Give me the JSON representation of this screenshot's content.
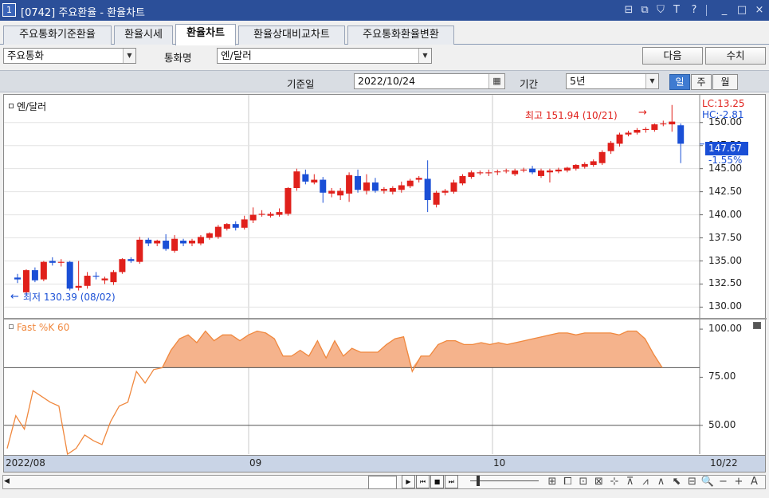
{
  "window": {
    "number": "1",
    "title": "[0742] 주요환율 - 환율차트",
    "controls": [
      "restore-icon",
      "popout-icon",
      "pin-icon",
      "font-icon",
      "help-icon",
      "minimize-icon",
      "maximize-icon",
      "close-icon"
    ],
    "control_glyphs": [
      "⊟",
      "⧉",
      "⛉",
      "T",
      "?",
      "_",
      "□",
      "×"
    ]
  },
  "tabs": [
    {
      "label": "주요통화기준환율",
      "active": false
    },
    {
      "label": "환율시세",
      "active": false
    },
    {
      "label": "환율차트",
      "active": true
    },
    {
      "label": "환율상대비교차트",
      "active": false
    },
    {
      "label": "주요통화환율변환",
      "active": false
    }
  ],
  "toolbar": {
    "category_select": "주요통화",
    "currency_label": "통화명",
    "currency_select": "엔/달러",
    "next_button": "다음",
    "value_button": "수치"
  },
  "query": {
    "base_date_label": "기준일",
    "base_date": "2022/10/24",
    "period_label": "기간",
    "period_select": "5년",
    "periods": [
      {
        "label": "일",
        "active": true
      },
      {
        "label": "주",
        "active": false
      },
      {
        "label": "월",
        "active": false
      }
    ]
  },
  "chart_data": [
    {
      "type": "candlestick",
      "title": "엔/달러",
      "lc_label": "LC:13.25",
      "hc_label": "HC:-2.81",
      "ylim": [
        129.0,
        153.0
      ],
      "ytick_labels": [
        "150.00",
        "147.50",
        "145.00",
        "142.50",
        "140.00",
        "137.50",
        "135.00",
        "132.50",
        "130.00"
      ],
      "ytick_values": [
        150,
        147.5,
        145,
        142.5,
        140,
        137.5,
        135,
        132.5,
        130
      ],
      "current_price": "147.67",
      "current_change": "-1.55%",
      "high_annotation": "최고 151.94 (10/21)",
      "low_annotation": "최저 130.39 (08/02)",
      "colors": {
        "up": "#e0201b",
        "down": "#1a4fd6"
      },
      "candles": [
        {
          "o": 133.2,
          "h": 133.6,
          "c": 133.0,
          "l": 132.6
        },
        {
          "o": 131.6,
          "h": 134.1,
          "c": 134.0,
          "l": 131.4
        },
        {
          "o": 134.0,
          "h": 134.3,
          "c": 132.9,
          "l": 132.7
        },
        {
          "o": 133.0,
          "h": 135.0,
          "c": 134.9,
          "l": 132.8
        },
        {
          "o": 135.0,
          "h": 135.4,
          "c": 134.8,
          "l": 134.5
        },
        {
          "o": 134.8,
          "h": 135.2,
          "c": 134.9,
          "l": 134.4
        },
        {
          "o": 134.9,
          "h": 135.0,
          "c": 132.0,
          "l": 131.8
        },
        {
          "o": 132.1,
          "h": 135.0,
          "c": 132.3,
          "l": 131.8
        },
        {
          "o": 132.3,
          "h": 133.8,
          "c": 133.4,
          "l": 132.0
        },
        {
          "o": 133.4,
          "h": 133.8,
          "c": 133.3,
          "l": 133.0
        },
        {
          "o": 132.9,
          "h": 133.3,
          "c": 133.1,
          "l": 132.5
        },
        {
          "o": 132.7,
          "h": 134.0,
          "c": 133.8,
          "l": 132.4
        },
        {
          "o": 133.8,
          "h": 135.3,
          "c": 135.2,
          "l": 133.6
        },
        {
          "o": 135.2,
          "h": 135.4,
          "c": 135.0,
          "l": 134.8
        },
        {
          "o": 134.9,
          "h": 137.6,
          "c": 137.3,
          "l": 134.7
        },
        {
          "o": 137.3,
          "h": 137.5,
          "c": 136.9,
          "l": 136.6
        },
        {
          "o": 136.9,
          "h": 137.3,
          "c": 137.2,
          "l": 136.6
        },
        {
          "o": 137.2,
          "h": 137.9,
          "c": 136.3,
          "l": 136.1
        },
        {
          "o": 136.1,
          "h": 137.8,
          "c": 137.4,
          "l": 135.9
        },
        {
          "o": 137.2,
          "h": 137.4,
          "c": 136.9,
          "l": 136.6
        },
        {
          "o": 136.9,
          "h": 137.4,
          "c": 137.2,
          "l": 136.6
        },
        {
          "o": 136.9,
          "h": 137.8,
          "c": 137.6,
          "l": 136.7
        },
        {
          "o": 137.5,
          "h": 138.1,
          "c": 138.0,
          "l": 137.3
        },
        {
          "o": 137.6,
          "h": 138.9,
          "c": 138.7,
          "l": 137.4
        },
        {
          "o": 138.5,
          "h": 139.1,
          "c": 139.0,
          "l": 138.3
        },
        {
          "o": 139.0,
          "h": 139.3,
          "c": 138.6,
          "l": 138.3
        },
        {
          "o": 138.6,
          "h": 139.9,
          "c": 139.5,
          "l": 138.4
        },
        {
          "o": 139.4,
          "h": 140.8,
          "c": 140.0,
          "l": 139.1
        },
        {
          "o": 140.0,
          "h": 140.5,
          "c": 140.1,
          "l": 139.8
        },
        {
          "o": 139.9,
          "h": 140.3,
          "c": 140.1,
          "l": 139.7
        },
        {
          "o": 140.0,
          "h": 140.7,
          "c": 140.3,
          "l": 139.8
        },
        {
          "o": 140.1,
          "h": 143.0,
          "c": 142.9,
          "l": 139.9
        },
        {
          "o": 142.9,
          "h": 145.0,
          "c": 144.7,
          "l": 142.6
        },
        {
          "o": 144.4,
          "h": 144.9,
          "c": 143.6,
          "l": 143.3
        },
        {
          "o": 143.5,
          "h": 144.4,
          "c": 143.8,
          "l": 143.3
        },
        {
          "o": 143.8,
          "h": 144.1,
          "c": 142.4,
          "l": 141.3
        },
        {
          "o": 142.3,
          "h": 142.9,
          "c": 142.6,
          "l": 141.9
        },
        {
          "o": 142.1,
          "h": 142.9,
          "c": 142.6,
          "l": 141.6
        },
        {
          "o": 142.3,
          "h": 144.6,
          "c": 144.3,
          "l": 141.4
        },
        {
          "o": 144.2,
          "h": 144.9,
          "c": 142.7,
          "l": 142.4
        },
        {
          "o": 142.6,
          "h": 144.4,
          "c": 143.5,
          "l": 142.2
        },
        {
          "o": 143.5,
          "h": 144.0,
          "c": 142.6,
          "l": 142.4
        },
        {
          "o": 142.6,
          "h": 143.0,
          "c": 142.8,
          "l": 142.3
        },
        {
          "o": 142.5,
          "h": 143.1,
          "c": 142.9,
          "l": 142.2
        },
        {
          "o": 142.7,
          "h": 143.6,
          "c": 143.2,
          "l": 142.4
        },
        {
          "o": 143.1,
          "h": 143.9,
          "c": 143.7,
          "l": 142.9
        },
        {
          "o": 143.8,
          "h": 144.2,
          "c": 144.0,
          "l": 143.5
        },
        {
          "o": 143.9,
          "h": 145.9,
          "c": 141.6,
          "l": 140.3
        },
        {
          "o": 141.1,
          "h": 142.6,
          "c": 142.4,
          "l": 140.8
        },
        {
          "o": 142.4,
          "h": 142.8,
          "c": 142.6,
          "l": 142.1
        },
        {
          "o": 142.5,
          "h": 143.8,
          "c": 143.5,
          "l": 142.3
        },
        {
          "o": 143.4,
          "h": 144.4,
          "c": 144.2,
          "l": 143.2
        },
        {
          "o": 144.1,
          "h": 144.8,
          "c": 144.6,
          "l": 143.9
        },
        {
          "o": 144.5,
          "h": 144.8,
          "c": 144.6,
          "l": 144.3
        },
        {
          "o": 144.5,
          "h": 144.9,
          "c": 144.6,
          "l": 144.2
        },
        {
          "o": 144.6,
          "h": 144.9,
          "c": 144.7,
          "l": 144.3
        },
        {
          "o": 144.7,
          "h": 145.0,
          "c": 144.8,
          "l": 144.5
        },
        {
          "o": 144.4,
          "h": 145.0,
          "c": 144.8,
          "l": 144.2
        },
        {
          "o": 144.8,
          "h": 145.1,
          "c": 144.9,
          "l": 144.6
        },
        {
          "o": 145.0,
          "h": 145.3,
          "c": 144.6,
          "l": 144.4
        },
        {
          "o": 144.2,
          "h": 145.0,
          "c": 144.8,
          "l": 144.0
        },
        {
          "o": 144.6,
          "h": 145.0,
          "c": 144.8,
          "l": 143.5
        },
        {
          "o": 144.7,
          "h": 145.1,
          "c": 144.9,
          "l": 144.5
        },
        {
          "o": 144.8,
          "h": 145.2,
          "c": 145.1,
          "l": 144.6
        },
        {
          "o": 145.0,
          "h": 145.5,
          "c": 145.4,
          "l": 144.8
        },
        {
          "o": 145.2,
          "h": 145.7,
          "c": 145.5,
          "l": 145.0
        },
        {
          "o": 145.4,
          "h": 146.0,
          "c": 145.8,
          "l": 145.2
        },
        {
          "o": 145.6,
          "h": 147.0,
          "c": 146.8,
          "l": 145.4
        },
        {
          "o": 146.9,
          "h": 148.0,
          "c": 147.8,
          "l": 146.6
        },
        {
          "o": 147.7,
          "h": 148.9,
          "c": 148.7,
          "l": 147.4
        },
        {
          "o": 148.7,
          "h": 149.1,
          "c": 148.9,
          "l": 148.5
        },
        {
          "o": 148.9,
          "h": 149.4,
          "c": 149.2,
          "l": 148.7
        },
        {
          "o": 149.2,
          "h": 149.5,
          "c": 149.3,
          "l": 148.9
        },
        {
          "o": 149.2,
          "h": 149.9,
          "c": 149.8,
          "l": 149.0
        },
        {
          "o": 149.8,
          "h": 150.2,
          "c": 149.9,
          "l": 149.6
        },
        {
          "o": 149.8,
          "h": 151.9,
          "c": 150.1,
          "l": 149.0
        },
        {
          "o": 149.7,
          "h": 149.9,
          "c": 147.7,
          "l": 145.6
        }
      ]
    },
    {
      "type": "area",
      "title": "Fast %K 60",
      "ylim": [
        35,
        105
      ],
      "ytick_labels": [
        "100.00",
        "75.00",
        "50.00"
      ],
      "ytick_values": [
        100,
        75,
        50
      ],
      "reference_lines": [
        80,
        50
      ],
      "colors": {
        "line": "#f0883e",
        "fill": "#f5b38c"
      },
      "values": [
        38,
        55,
        48,
        68,
        65,
        62,
        60,
        35,
        38,
        45,
        42,
        40,
        52,
        60,
        62,
        78,
        72,
        79,
        80,
        89,
        95,
        97,
        93,
        99,
        94,
        97,
        97,
        94,
        97,
        99,
        98,
        95,
        86,
        86,
        89,
        86,
        94,
        85,
        94,
        86,
        90,
        88,
        88,
        88,
        92,
        95,
        96,
        78,
        86,
        86,
        92,
        94,
        94,
        92,
        92,
        93,
        92,
        93,
        92,
        93,
        94,
        95,
        96,
        97,
        98,
        98,
        97,
        98,
        98,
        98,
        98,
        97,
        99,
        99,
        95,
        87,
        80
      ],
      "x_labels": [
        "2022/08",
        "09",
        "10",
        "10/22"
      ]
    }
  ],
  "bottombar": {
    "scroll_left_icon": "◀",
    "nav_buttons": [
      "▶",
      "⏮",
      "■",
      "⏭"
    ],
    "tools": [
      "line-tool-icon",
      "rect-tool-icon",
      "multi-window-icon",
      "overlay-icon",
      "crosshair-icon",
      "trend-icon",
      "wave-icon",
      "angle-icon",
      "select-icon",
      "stats-icon",
      "zoom-icon",
      "zoom-out-icon",
      "zoom-in-icon",
      "auto-icon"
    ],
    "tool_glyphs": [
      "⊞",
      "⧠",
      "⊡",
      "⊠",
      "⊹",
      "⊼",
      "⩘",
      "∧",
      "⬉",
      "⊟",
      "🔍",
      "−",
      "+",
      "A"
    ]
  }
}
